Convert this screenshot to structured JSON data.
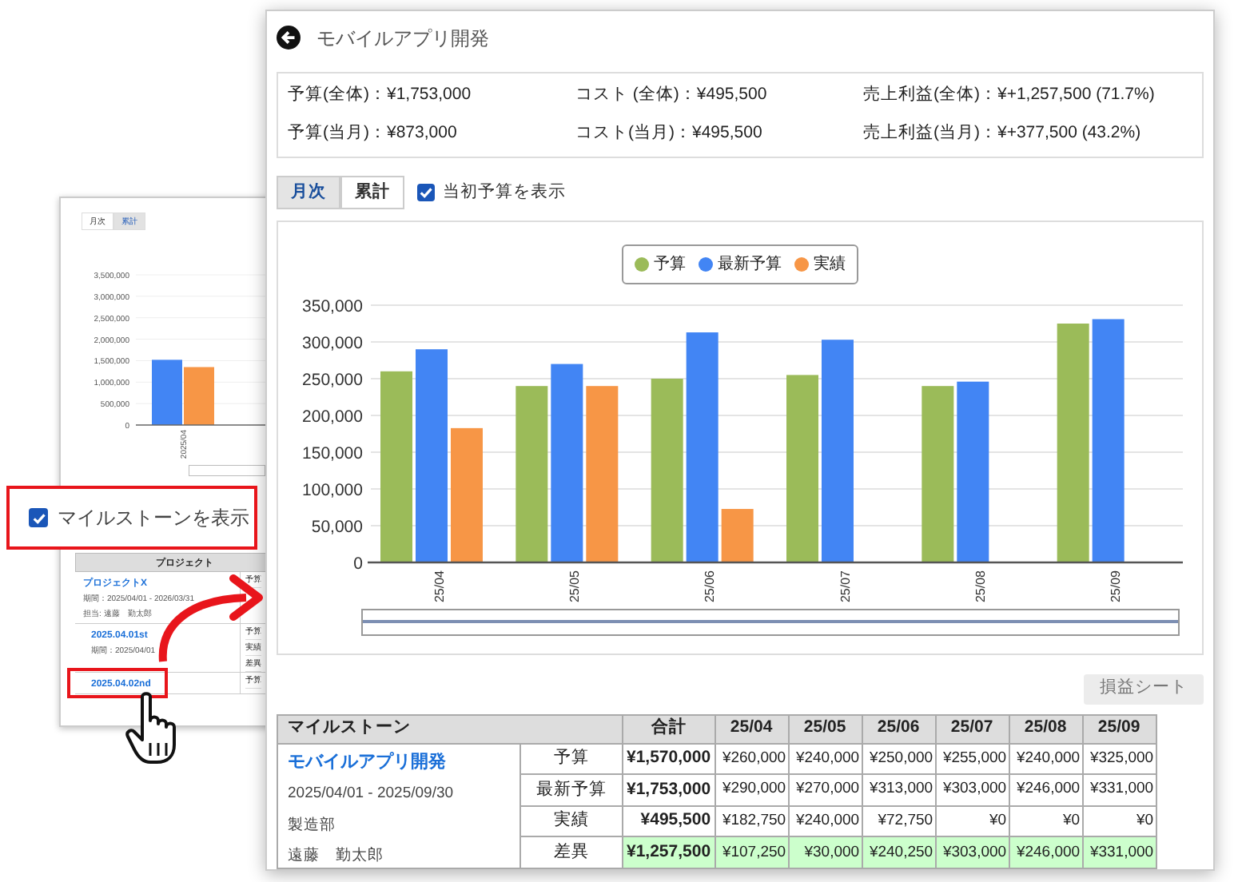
{
  "main_panel": {
    "title": "モバイルアプリ開発",
    "summary": [
      "予算(全体)：¥1,753,000",
      "コスト (全体)：¥495,500",
      "売上利益(全体)：¥+1,257,500 (71.7%)",
      "予算(当月)：¥873,000",
      "コスト(当月)：¥495,500",
      "売上利益(当月)：¥+377,500 (43.2%)"
    ],
    "view_tabs": [
      {
        "label": "月次",
        "selected": true
      },
      {
        "label": "累計",
        "selected": false
      }
    ],
    "initial_budget_checkbox": {
      "label": "当初予算を表示",
      "checked": true
    },
    "chart_data": {
      "type": "bar",
      "categories": [
        "25/04",
        "25/05",
        "25/06",
        "25/07",
        "25/08",
        "25/09"
      ],
      "series": [
        {
          "name": "予算",
          "color": "#9bbb59",
          "values": [
            260000,
            240000,
            250000,
            255000,
            240000,
            325000
          ]
        },
        {
          "name": "最新予算",
          "color": "#4285f4",
          "values": [
            290000,
            270000,
            313000,
            303000,
            246000,
            331000
          ]
        },
        {
          "name": "実績",
          "color": "#f79646",
          "values": [
            182750,
            240000,
            72750,
            0,
            0,
            0
          ]
        }
      ],
      "ylim": [
        0,
        350000
      ],
      "grid": true,
      "yticks": [
        {
          "value": 0,
          "label": "0"
        },
        {
          "value": 50000,
          "label": "50,000"
        },
        {
          "value": 100000,
          "label": "100,000"
        },
        {
          "value": 150000,
          "label": "150,000"
        },
        {
          "value": 200000,
          "label": "200,000"
        },
        {
          "value": 250000,
          "label": "250,000"
        },
        {
          "value": 300000,
          "label": "300,000"
        },
        {
          "value": 350000,
          "label": "350,000"
        }
      ]
    },
    "pl_sheet_button": "損益シート",
    "milestone_table": {
      "columns": [
        "マイルストーン",
        "合計",
        "25/04",
        "25/05",
        "25/06",
        "25/07",
        "25/08",
        "25/09"
      ],
      "milestone": {
        "name": "モバイルアプリ開発",
        "period": "2025/04/01 - 2025/09/30",
        "department": "製造部",
        "owner": "遠藤　勤太郎"
      },
      "rows": [
        {
          "label": "予算",
          "total": "¥1,570,000",
          "values": [
            "¥260,000",
            "¥240,000",
            "¥250,000",
            "¥255,000",
            "¥240,000",
            "¥325,000"
          ],
          "highlighted": false
        },
        {
          "label": "最新予算",
          "total": "¥1,753,000",
          "values": [
            "¥290,000",
            "¥270,000",
            "¥313,000",
            "¥303,000",
            "¥246,000",
            "¥331,000"
          ],
          "highlighted": false
        },
        {
          "label": "実績",
          "total": "¥495,500",
          "values": [
            "¥182,750",
            "¥240,000",
            "¥72,750",
            "¥0",
            "¥0",
            "¥0"
          ],
          "highlighted": false
        },
        {
          "label": "差異",
          "total": "¥1,257,500",
          "values": [
            "¥107,250",
            "¥30,000",
            "¥240,250",
            "¥303,000",
            "¥246,000",
            "¥331,000"
          ],
          "highlighted": true
        }
      ]
    }
  },
  "background_window": {
    "view_tabs": [
      {
        "label": "月次",
        "selected": false
      },
      {
        "label": "累計",
        "selected": true
      }
    ],
    "chart_data": {
      "type": "bar",
      "categories": [
        "2025/04"
      ],
      "series": [
        {
          "color": "#4285f4",
          "values": [
            1520000
          ]
        },
        {
          "color": "#f79646",
          "values": [
            1350000
          ]
        }
      ],
      "ylim": [
        0,
        3500000
      ],
      "grid": true,
      "yticks": [
        {
          "value": 0,
          "label": "0"
        },
        {
          "value": 500000,
          "label": "500,000"
        },
        {
          "value": 1000000,
          "label": "1,000,000"
        },
        {
          "value": 1500000,
          "label": "1,500,000"
        },
        {
          "value": 2000000,
          "label": "2,000,000"
        },
        {
          "value": 2500000,
          "label": "2,500,000"
        },
        {
          "value": 3000000,
          "label": "3,000,000"
        },
        {
          "value": 3500000,
          "label": "3,500,000"
        }
      ]
    },
    "table_header": "プロジェクト",
    "groups": [
      {
        "name": "プロジェクトX",
        "kind": "project",
        "details": [
          "期間：2025/04/01 - 2026/03/31",
          "担当: 遠藤　勤太郎"
        ],
        "cells": [
          "予算"
        ]
      },
      {
        "name": "2025.04.01st",
        "kind": "milestone",
        "details": [
          "期間：2025/04/01"
        ],
        "cells": [
          "予算",
          "実績",
          "差異"
        ]
      },
      {
        "name": "2025.04.02nd",
        "kind": "milestone",
        "cells": [
          "予算"
        ]
      }
    ]
  },
  "callout": {
    "label": "マイルストーンを表示",
    "checked": true
  }
}
